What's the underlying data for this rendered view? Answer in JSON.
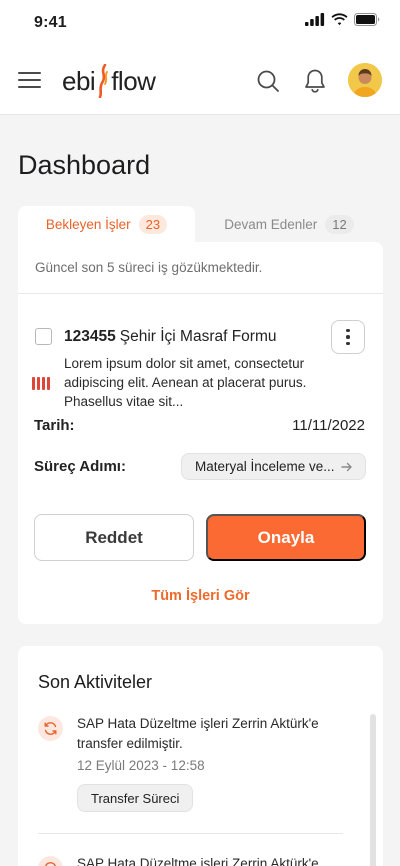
{
  "status_bar": {
    "time": "9:41"
  },
  "app": {
    "logo_left": "ebi",
    "logo_right": "flow"
  },
  "page": {
    "title": "Dashboard"
  },
  "tabs": [
    {
      "label": "Bekleyen İşler",
      "count": "23",
      "active": true
    },
    {
      "label": "Devam Edenler",
      "count": "12",
      "active": false
    }
  ],
  "pending": {
    "subtitle": "Güncel son 5 süreci iş gözükmektedir.",
    "item": {
      "id": "123455",
      "name": "Şehir İçi Masraf Formu",
      "description": "Lorem ipsum dolor sit amet, consectetur adipiscing elit. Aenean at placerat purus. Phasellus vitae sit...",
      "date_label": "Tarih:",
      "date_value": "11/11/2022",
      "step_label": "Süreç Adımı:",
      "step_value": "Materyal İnceleme ve...",
      "priority_color": "#e0453a"
    },
    "reject_label": "Reddet",
    "approve_label": "Onayla",
    "see_all_label": "Tüm İşleri Gör"
  },
  "activities": {
    "title": "Son Aktiviteler",
    "items": [
      {
        "text": "SAP Hata Düzeltme işleri Zerrin Aktürk'e transfer edilmiştir.",
        "time": "12 Eylül 2023 - 12:58",
        "chip": "Transfer Süreci"
      },
      {
        "text": "SAP Hata Düzeltme işleri Zerrin Aktürk'e"
      }
    ]
  },
  "colors": {
    "accent": "#fb6a32",
    "accent_text": "#e8622a",
    "badge_bg": "#fde8dd"
  }
}
